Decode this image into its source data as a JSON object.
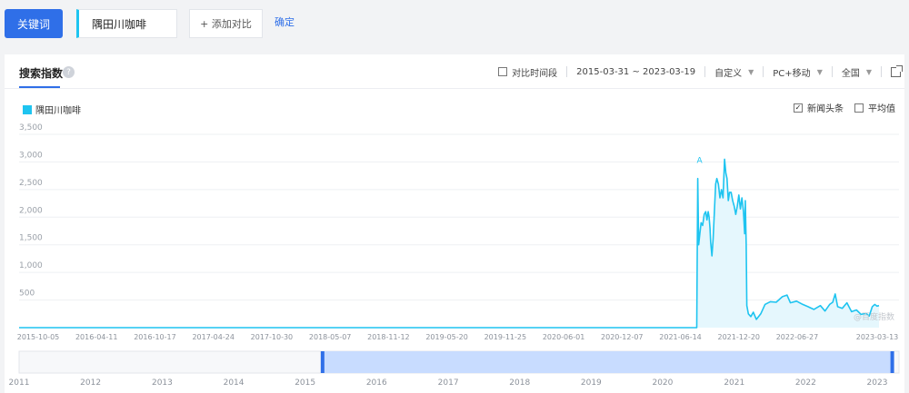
{
  "toolbar": {
    "keyword_button": "关键词",
    "keyword_value": "隅田川咖啡",
    "add_compare": "+ 添加对比",
    "confirm": "确定"
  },
  "panel": {
    "title": "搜索指数",
    "help_glyph": "?",
    "controls": {
      "compare_period": "对比时间段",
      "date_range": "2015-03-31 ~ 2023-03-19",
      "custom": "自定义",
      "device": "PC+移动",
      "region": "全国"
    },
    "legend": "隅田川咖啡",
    "options": {
      "news_headlines": "新闻头条",
      "news_checked": true,
      "average": "平均值",
      "average_checked": false
    },
    "watermark": "@百度指数"
  },
  "colors": {
    "accent": "#2f6fe8",
    "series": "#1ec4f0"
  },
  "chart_data": {
    "type": "area",
    "title": "",
    "ylim": [
      0,
      3500
    ],
    "y_ticks": [
      "3,500",
      "3,000",
      "2,500",
      "2,000",
      "1,500",
      "1,000",
      "500"
    ],
    "x_ticks": [
      "2015-10-05",
      "2016-04-11",
      "2016-10-17",
      "2017-04-24",
      "2017-10-30",
      "2018-05-07",
      "2018-11-12",
      "2019-05-20",
      "2019-11-25",
      "2020-06-01",
      "2020-12-07",
      "2021-06-14",
      "2021-12-20",
      "2022-06-27",
      "2023-03-13"
    ],
    "annotation": {
      "label": "A",
      "date": "2021-08-15",
      "value": 2750
    },
    "series": [
      {
        "name": "隅田川咖啡",
        "points": [
          [
            "2015-03-31",
            0
          ],
          [
            "2016-06-01",
            0
          ],
          [
            "2017-06-01",
            0
          ],
          [
            "2018-06-01",
            0
          ],
          [
            "2019-06-01",
            0
          ],
          [
            "2020-06-01",
            0
          ],
          [
            "2021-01-01",
            0
          ],
          [
            "2021-08-06",
            0
          ],
          [
            "2021-08-09",
            2700
          ],
          [
            "2021-08-12",
            1500
          ],
          [
            "2021-08-16",
            1700
          ],
          [
            "2021-08-20",
            1900
          ],
          [
            "2021-08-25",
            1850
          ],
          [
            "2021-08-30",
            2050
          ],
          [
            "2021-09-04",
            2100
          ],
          [
            "2021-09-08",
            1950
          ],
          [
            "2021-09-12",
            2100
          ],
          [
            "2021-09-15",
            2000
          ],
          [
            "2021-09-18",
            1800
          ],
          [
            "2021-09-20",
            1550
          ],
          [
            "2021-09-24",
            1300
          ],
          [
            "2021-09-28",
            1600
          ],
          [
            "2021-10-02",
            2100
          ],
          [
            "2021-10-06",
            2600
          ],
          [
            "2021-10-10",
            2700
          ],
          [
            "2021-10-15",
            2600
          ],
          [
            "2021-10-20",
            2350
          ],
          [
            "2021-10-25",
            2500
          ],
          [
            "2021-10-30",
            2350
          ],
          [
            "2021-11-04",
            3050
          ],
          [
            "2021-11-08",
            2800
          ],
          [
            "2021-11-12",
            2700
          ],
          [
            "2021-11-16",
            2300
          ],
          [
            "2021-11-20",
            2450
          ],
          [
            "2021-11-25",
            2450
          ],
          [
            "2021-11-30",
            2300
          ],
          [
            "2021-12-05",
            2200
          ],
          [
            "2021-12-10",
            2050
          ],
          [
            "2021-12-15",
            2200
          ],
          [
            "2021-12-20",
            2400
          ],
          [
            "2021-12-25",
            2150
          ],
          [
            "2021-12-30",
            2350
          ],
          [
            "2022-01-04",
            2100
          ],
          [
            "2022-01-08",
            1700
          ],
          [
            "2022-01-10",
            2300
          ],
          [
            "2022-01-13",
            1500
          ],
          [
            "2022-01-15",
            400
          ],
          [
            "2022-01-20",
            250
          ],
          [
            "2022-01-28",
            200
          ],
          [
            "2022-02-05",
            280
          ],
          [
            "2022-02-15",
            150
          ],
          [
            "2022-03-01",
            250
          ],
          [
            "2022-03-15",
            420
          ],
          [
            "2022-04-01",
            470
          ],
          [
            "2022-04-20",
            460
          ],
          [
            "2022-05-10",
            560
          ],
          [
            "2022-05-25",
            590
          ],
          [
            "2022-06-05",
            450
          ],
          [
            "2022-06-25",
            480
          ],
          [
            "2022-07-15",
            420
          ],
          [
            "2022-08-01",
            380
          ],
          [
            "2022-08-20",
            330
          ],
          [
            "2022-09-10",
            400
          ],
          [
            "2022-09-25",
            300
          ],
          [
            "2022-10-10",
            420
          ],
          [
            "2022-10-20",
            460
          ],
          [
            "2022-10-28",
            610
          ],
          [
            "2022-11-05",
            380
          ],
          [
            "2022-11-20",
            350
          ],
          [
            "2022-12-05",
            450
          ],
          [
            "2022-12-20",
            290
          ],
          [
            "2023-01-05",
            320
          ],
          [
            "2023-01-20",
            240
          ],
          [
            "2023-02-05",
            260
          ],
          [
            "2023-02-15",
            210
          ],
          [
            "2023-02-25",
            380
          ],
          [
            "2023-03-05",
            420
          ],
          [
            "2023-03-12",
            390
          ],
          [
            "2023-03-19",
            400
          ]
        ]
      }
    ],
    "navigator": {
      "year_labels": [
        "2011",
        "2012",
        "2013",
        "2014",
        "2015",
        "2016",
        "2017",
        "2018",
        "2019",
        "2020",
        "2021",
        "2022",
        "2023"
      ],
      "selected_start": "2015-03-31",
      "selected_end": "2023-03-19"
    }
  }
}
